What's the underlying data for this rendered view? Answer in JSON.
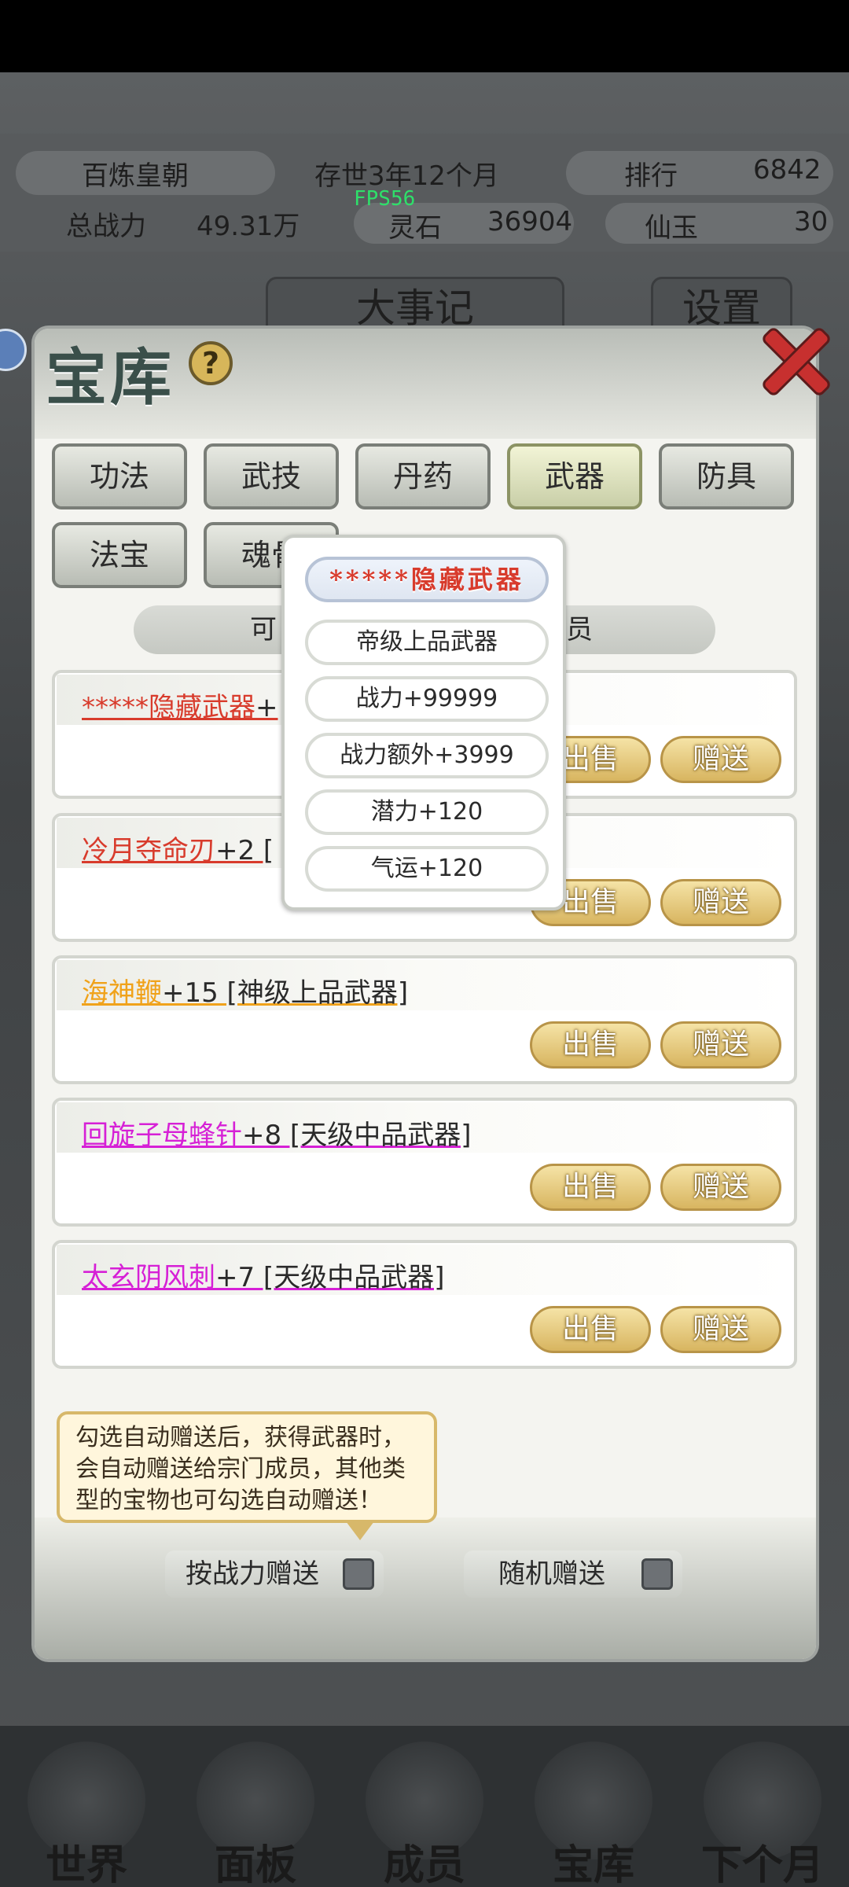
{
  "header": {
    "dynasty": "百炼皇朝",
    "age": "存世3年12个月",
    "rank_label": "排行",
    "rank_value": "6842",
    "power_label": "总战力",
    "power_value": "49.31万",
    "stone_label": "灵石",
    "stone_value": "36904",
    "jade_label": "仙玉",
    "jade_value": "30",
    "fps": "FPS56"
  },
  "behind": {
    "tab_center": "大事记",
    "tab_right": "设置"
  },
  "panel": {
    "title": "宝库",
    "help": "?",
    "tabs": [
      "功法",
      "武技",
      "丹药",
      "武器",
      "防具",
      "法宝",
      "魂骨"
    ],
    "active_tab": "武器",
    "filter_left": "可",
    "filter_right": "员"
  },
  "items": [
    {
      "name": "*****隐藏武器",
      "extra": "+",
      "color": "#d83b2c",
      "sell": "出售",
      "gift": "赠送"
    },
    {
      "name": "冷月夺命刃",
      "extra": "+2 [",
      "color": "#d83b2c",
      "sell": "出售",
      "gift": "赠送"
    },
    {
      "name": "海神鞭",
      "extra": "+15 [神级上品武器]",
      "color": "#f0a21a",
      "sell": "出售",
      "gift": "赠送"
    },
    {
      "name": "回旋子母蜂针",
      "extra": "+8 [天级中品武器]",
      "color": "#d620d6",
      "sell": "出售",
      "gift": "赠送"
    },
    {
      "name": "太玄阴风刺",
      "extra": "+7 [天级中品武器]",
      "color": "#d620d6",
      "sell": "出售",
      "gift": "赠送"
    }
  ],
  "popup": {
    "title": "*****隐藏武器",
    "rows": [
      "帝级上品武器",
      "战力+99999",
      "战力额外+3999",
      "潜力+120",
      "气运+120"
    ]
  },
  "tip": {
    "line1": "勾选自动赠送后，获得武器时，",
    "line2": "会自动赠送给宗门成员，其他类",
    "line3": "型的宝物也可勾选自动赠送！"
  },
  "toggles": {
    "by_power": "按战力赠送",
    "random": "随机赠送"
  },
  "nav": [
    "世界",
    "面板",
    "成员",
    "宝库",
    "下个月"
  ],
  "colors": {
    "red_item": "#d83b2c",
    "gold_item": "#f0a21a",
    "purple_item": "#d620d6",
    "button_gold": "#d8b560"
  }
}
